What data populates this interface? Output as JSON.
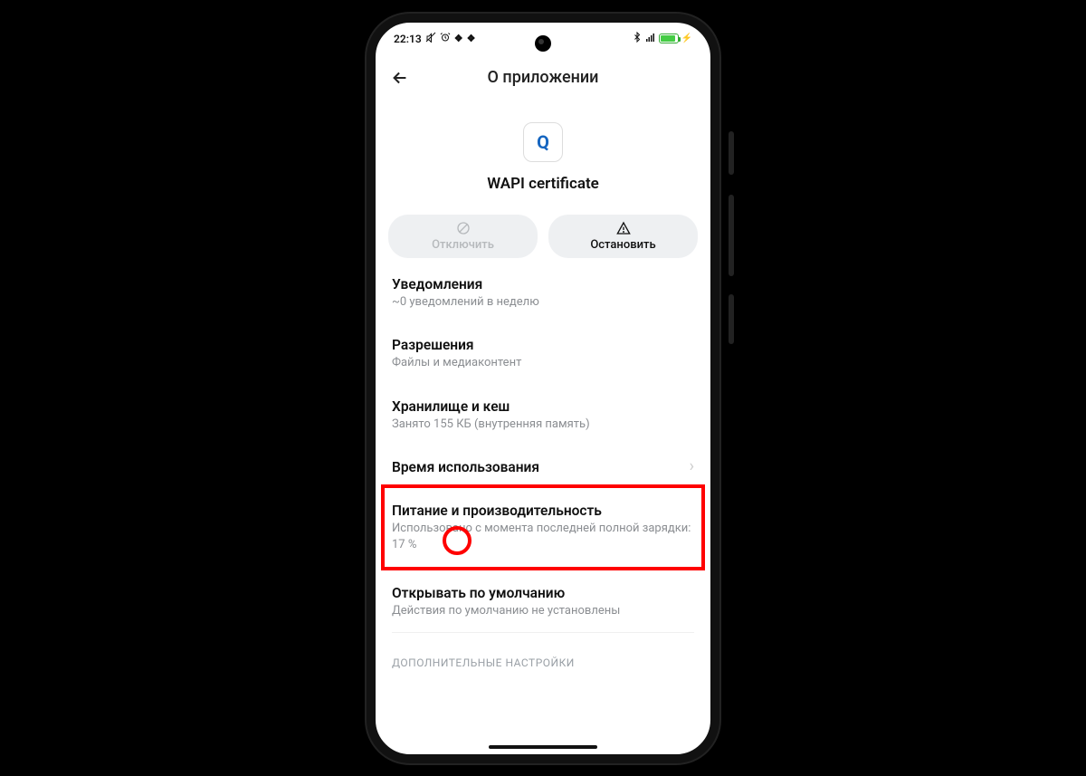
{
  "statusbar": {
    "time": "22:13",
    "icons_left": [
      "mute-icon",
      "alarm-icon",
      "misc-icon",
      "misc-icon"
    ],
    "icons_right": [
      "bt-icon",
      "signal-icon",
      "battery-icon",
      "charge-icon"
    ]
  },
  "header": {
    "title": "О приложении"
  },
  "app": {
    "name": "WAPI certificate",
    "icon_letter": "Q"
  },
  "actions": {
    "disable": {
      "label": "Отключить"
    },
    "stop": {
      "label": "Остановить"
    }
  },
  "items": [
    {
      "title": "Уведомления",
      "sub": "~0 уведомлений в неделю"
    },
    {
      "title": "Разрешения",
      "sub": "Файлы и медиаконтент"
    },
    {
      "title": "Хранилище и кеш",
      "sub": "Занято 155 КБ (внутренняя память)"
    },
    {
      "title": "Время использования",
      "sub": ""
    },
    {
      "title": "Питание и производительность",
      "sub": "Использовано с момента последней полной зарядки: 17 %"
    },
    {
      "title": "Открывать по умолчанию",
      "sub": "Действия по умолчанию не установлены"
    }
  ],
  "section_label": "ДОПОЛНИТЕЛЬНЫЕ НАСТРОЙКИ",
  "annotations": {
    "highlighted_item_index": 4,
    "circled_value": "17 %"
  }
}
